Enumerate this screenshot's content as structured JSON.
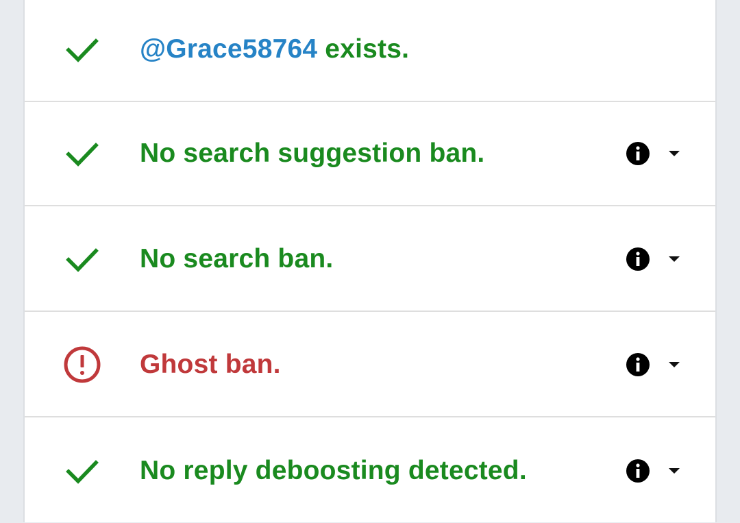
{
  "colors": {
    "ok": "#1a8a1f",
    "bad": "#c0393b",
    "handle": "#2683c6",
    "page_background": "#e8ebef"
  },
  "rows": [
    {
      "status": "ok",
      "icon": "check-icon",
      "handle": "@Grace58764",
      "text": " exists."
    },
    {
      "status": "ok",
      "icon": "check-icon",
      "text": "No search suggestion ban.",
      "has_info": true
    },
    {
      "status": "ok",
      "icon": "check-icon",
      "text": "No search ban.",
      "has_info": true
    },
    {
      "status": "bad",
      "icon": "alert-circle-icon",
      "text": "Ghost ban.",
      "has_info": true
    },
    {
      "status": "ok",
      "icon": "check-icon",
      "text": "No reply deboosting detected.",
      "has_info": true
    }
  ]
}
